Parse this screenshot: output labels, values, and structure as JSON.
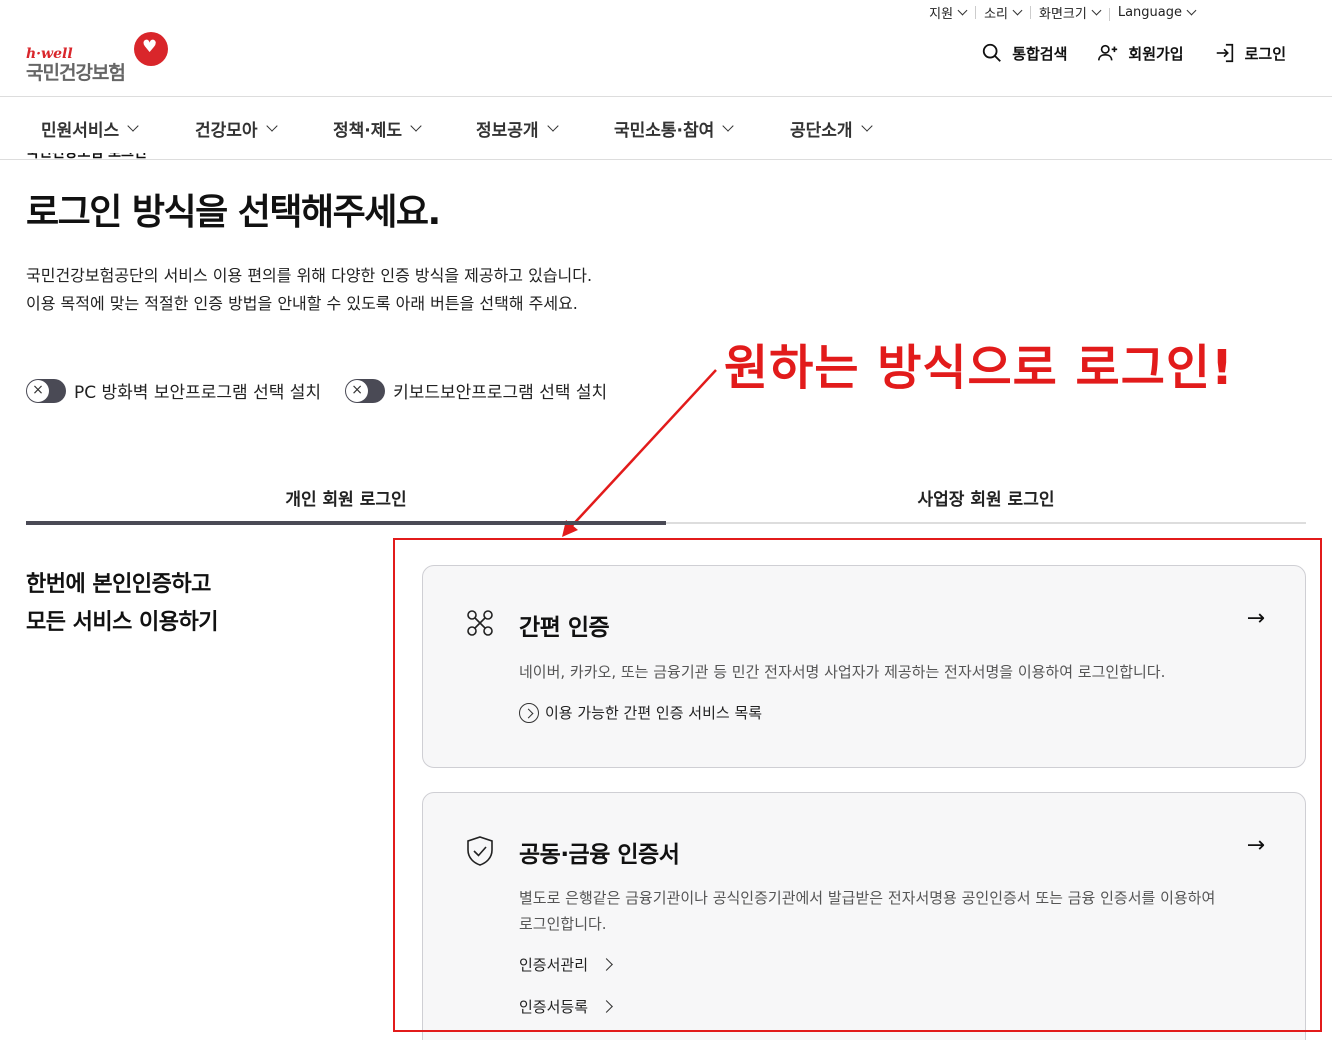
{
  "utility": {
    "items": [
      {
        "label": "지원"
      },
      {
        "label": "소리"
      },
      {
        "label": "화면크기"
      },
      {
        "label": "Language"
      }
    ]
  },
  "logo": {
    "tagline": "h·well",
    "name": "국민건강보험"
  },
  "header_actions": {
    "search": "통합검색",
    "signup": "회원가입",
    "login": "로그인"
  },
  "nav": {
    "items": [
      "민원서비스",
      "건강모아",
      "정책·제도",
      "정보공개",
      "국민소통·참여",
      "공단소개"
    ]
  },
  "page": {
    "breadcrumb": "국민건강보험 로그인",
    "title": "로그인 방식을 선택해주세요.",
    "desc_line1": "국민건강보험공단의 서비스 이용 편의를 위해 다양한 인증 방식을 제공하고 있습니다.",
    "desc_line2": "이용 목적에 맞는 적절한 인증 방법을 안내할 수 있도록 아래 버튼을 선택해 주세요."
  },
  "toggles": [
    {
      "label": "PC 방화벽 보안프로그램 선택 설치",
      "on": false
    },
    {
      "label": "키보드보안프로그램 선택 설치",
      "on": false
    }
  ],
  "annotation": {
    "text": "원하는 방식으로 로그인!",
    "color": "#e21b1b"
  },
  "tabs": [
    {
      "label": "개인 회원 로그인",
      "active": true
    },
    {
      "label": "사업장 회원 로그인",
      "active": false
    }
  ],
  "lead": {
    "line1": "한번에 본인인증하고",
    "line2": "모든 서비스 이용하기"
  },
  "cards": [
    {
      "icon": "network-icon",
      "title": "간편 인증",
      "desc": "네이버, 카카오, 또는 금융기관 등 민간 전자서명 사업자가 제공하는 전자서명을 이용하여 로그인합니다.",
      "link": "이용 가능한 간편 인증 서비스 목록"
    },
    {
      "icon": "shield-check-icon",
      "title": "공동·금융 인증서",
      "desc": "별도로 은행같은 금융기관이나 공식인증기관에서 발급받은 전자서명용 공인인증서 또는 금융 인증서를 이용하여 로그인합니다.",
      "link1": "인증서관리",
      "link2": "인증서등록"
    }
  ],
  "arrow_glyph": "→"
}
